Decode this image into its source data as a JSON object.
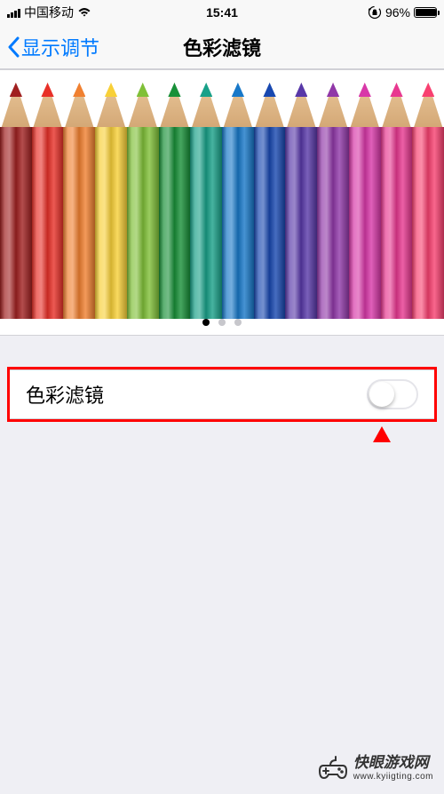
{
  "status": {
    "carrier": "中国移动",
    "time": "15:41",
    "battery": "96%"
  },
  "nav": {
    "back_label": "显示调节",
    "title": "色彩滤镜"
  },
  "pencils": {
    "colors": [
      "#a02020",
      "#e83028",
      "#f08030",
      "#f8d038",
      "#80c038",
      "#189038",
      "#18a088",
      "#1878c8",
      "#1848b0",
      "#5838a8",
      "#9038a8",
      "#d838a8",
      "#e83890",
      "#f84070"
    ]
  },
  "pager": {
    "dots": 3,
    "active_index": 0
  },
  "settings": {
    "color_filter_label": "色彩滤镜",
    "color_filter_on": false
  },
  "watermark": {
    "title": "快眼游戏网",
    "url": "www.kyiigting.com"
  }
}
